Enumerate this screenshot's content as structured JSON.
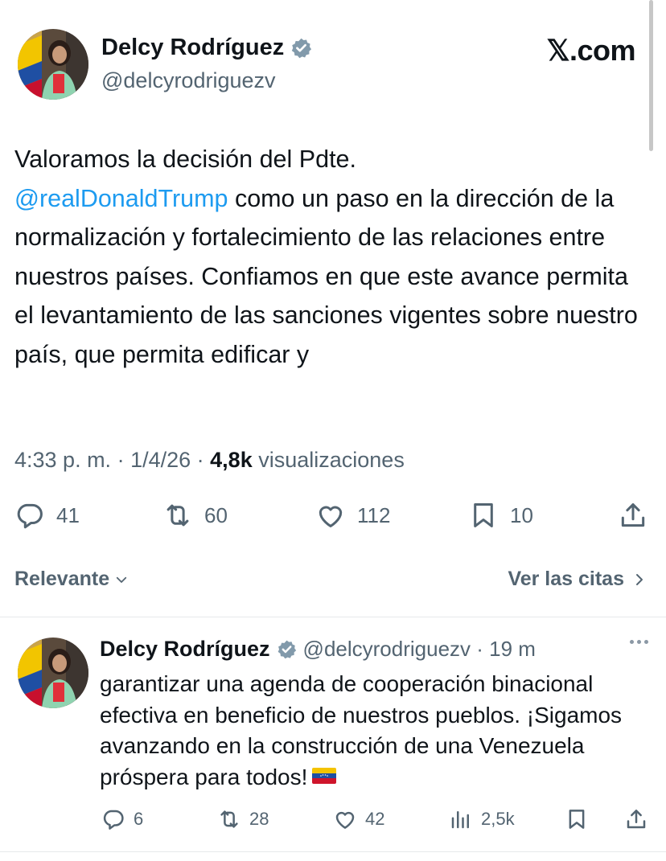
{
  "header": {
    "display_name": "Delcy Rodríguez",
    "handle": "@delcyrodriguezv",
    "site": "𝕏.com"
  },
  "tweet": {
    "text_before_mention": "Valoramos la decisión del Pdte.",
    "mention": "@realDonaldTrump",
    "text_after_mention": " como un paso en la dirección de la normalización y fortalecimiento de las relaciones entre nuestros países. Confiamos en que este avance permita el levantamiento de las sanciones vigentes sobre nuestro país, que permita edificar y",
    "time": "4:33 p. m.",
    "date": "1/4/26",
    "views_count": "4,8k",
    "views_label": "visualizaciones",
    "replies": "41",
    "reposts": "60",
    "likes": "112",
    "bookmarks": "10"
  },
  "controls": {
    "sort_label": "Relevante",
    "quotes_label": "Ver las citas"
  },
  "reply": {
    "display_name": "Delcy Rodríguez",
    "handle_time": "@delcyrodriguezv · 19 m",
    "text": "garantizar una agenda de cooperación binacional efectiva en beneficio de nuestros pueblos. ¡Sigamos avanzando en la construcción de una Venezuela próspera para todos!",
    "replies": "6",
    "reposts": "28",
    "likes": "42",
    "views": "2,5k"
  },
  "icons": {
    "verified": "verified-badge-icon",
    "reply": "reply-icon",
    "repost": "repost-icon",
    "like": "heart-icon",
    "bookmark": "bookmark-icon",
    "share": "share-icon",
    "views": "views-icon",
    "more": "more-icon",
    "flag": "venezuela-flag-icon"
  },
  "colors": {
    "mention": "#1d9bf0",
    "secondary_text": "#536471",
    "primary_text": "#0f1419"
  }
}
